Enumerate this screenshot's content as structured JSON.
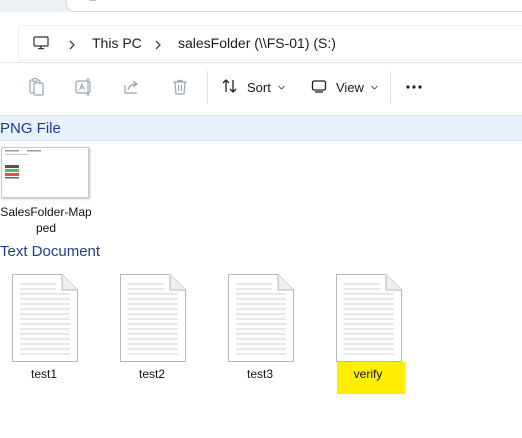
{
  "breadcrumb": {
    "items": [
      "This PC",
      "salesFolder (\\\\FS-01) (S:)"
    ]
  },
  "toolbar": {
    "sort_label": "Sort",
    "view_label": "View",
    "icons": [
      "copy-icon",
      "rename-icon",
      "share-icon",
      "delete-icon",
      "sort-icon",
      "view-icon",
      "more-icon"
    ]
  },
  "groups": [
    {
      "title": "PNG File",
      "selected": true,
      "items": [
        {
          "name_line1": "SalesFolder-Map",
          "name_line2": "ped"
        }
      ]
    },
    {
      "title": "Text Document",
      "selected": false,
      "items": [
        {
          "name": "test1",
          "highlighted": false
        },
        {
          "name": "test2",
          "highlighted": false
        },
        {
          "name": "test3",
          "highlighted": false
        },
        {
          "name": "verify",
          "highlighted": true
        }
      ]
    }
  ],
  "colors": {
    "group_title": "#1e3f8f",
    "selection_band": "#e7f1fb",
    "highlight": "#ffee00",
    "accent": "#0067c0"
  }
}
